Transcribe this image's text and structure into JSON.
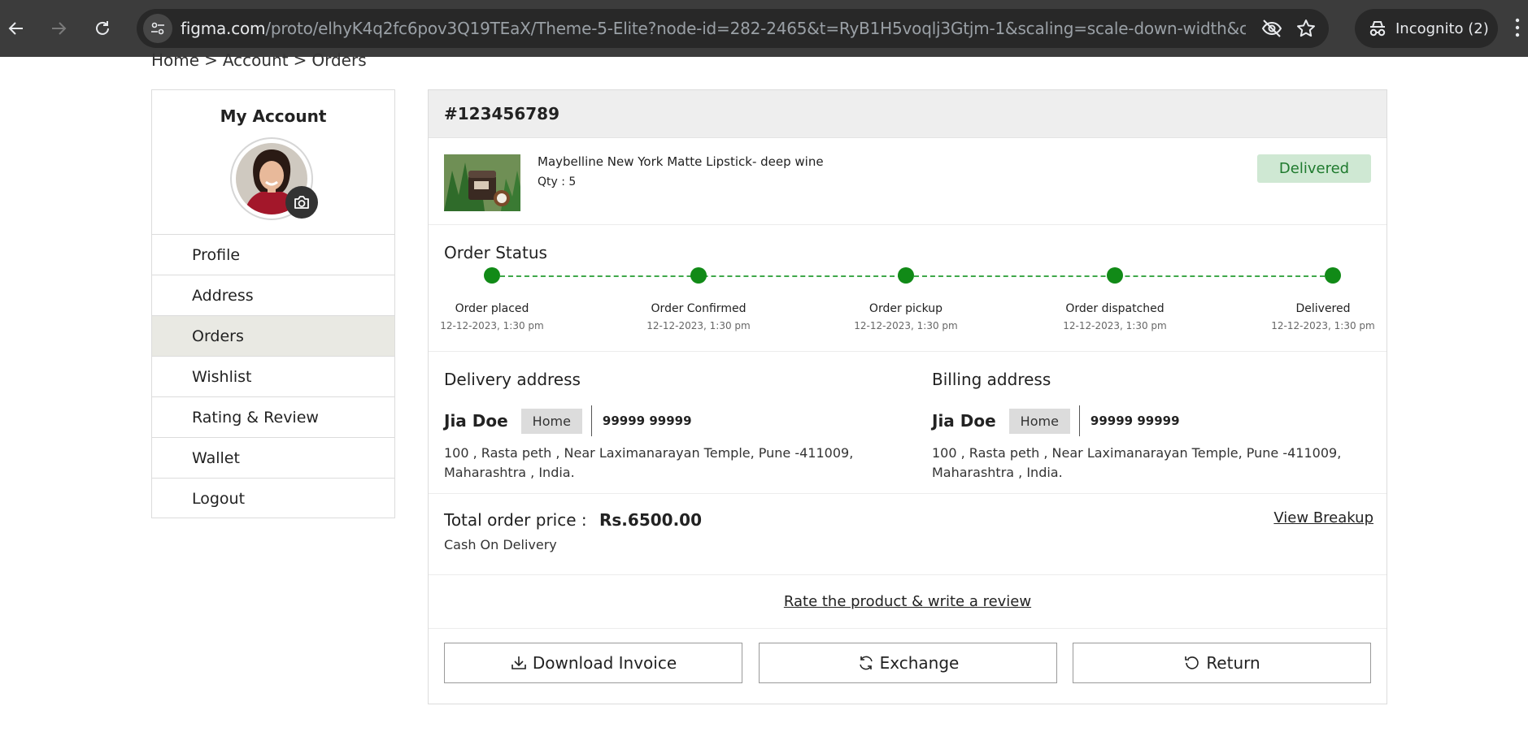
{
  "browser": {
    "url_host": "figma.com",
    "url_path": "/proto/elhyK4q2fc6pov3Q19TEaX/Theme-5-Elite?node-id=282-2465&t=RyB1H5voqlj3Gtjm-1&scaling=scale-down-width&conte...",
    "incognito_label": "Incognito (2)"
  },
  "breadcrumb": {
    "items": [
      "Home",
      "Account",
      "Orders"
    ],
    "separator": ">"
  },
  "sidebar": {
    "title": "My Account",
    "items": [
      {
        "label": "Profile"
      },
      {
        "label": "Address"
      },
      {
        "label": "Orders",
        "active": true
      },
      {
        "label": "Wishlist"
      },
      {
        "label": "Rating & Review"
      },
      {
        "label": "Wallet"
      },
      {
        "label": "Logout"
      }
    ]
  },
  "order": {
    "number": "#123456789",
    "product": {
      "name": "Maybelline New York Matte Lipstick-  deep wine",
      "qty": "Qty : 5"
    },
    "status_badge": "Delivered",
    "status_title": "Order Status",
    "steps": [
      {
        "label": "Order placed",
        "date": "12-12-2023, 1:30 pm"
      },
      {
        "label": "Order Confirmed",
        "date": "12-12-2023, 1:30 pm"
      },
      {
        "label": "Order pickup",
        "date": "12-12-2023, 1:30 pm"
      },
      {
        "label": "Order dispatched",
        "date": "12-12-2023, 1:30 pm"
      },
      {
        "label": "Delivered",
        "date": "12-12-2023, 1:30 pm"
      }
    ],
    "delivery": {
      "title": "Delivery address",
      "name": "Jia Doe",
      "tag": "Home",
      "phone": "99999 99999",
      "line1": "100 , Rasta peth , Near Laximanarayan Temple, Pune -411009,",
      "line2": "Maharashtra , India."
    },
    "billing": {
      "title": "Billing address",
      "name": "Jia Doe",
      "tag": "Home",
      "phone": "99999 99999",
      "line1": "100 , Rasta peth , Near Laximanarayan Temple, Pune -411009,",
      "line2": "Maharashtra , India."
    },
    "price_label": "Total order price :",
    "price_value": "Rs.6500.00",
    "payment_method": "Cash On Delivery",
    "view_breakup": "View Breakup",
    "review_link": "Rate the product & write a review",
    "actions": {
      "download": "Download Invoice",
      "exchange": "Exchange",
      "return": "Return"
    }
  },
  "colors": {
    "accent_green": "#118a17",
    "badge_bg": "#cfe8d3",
    "active_menu_bg": "#e9e9e3"
  }
}
